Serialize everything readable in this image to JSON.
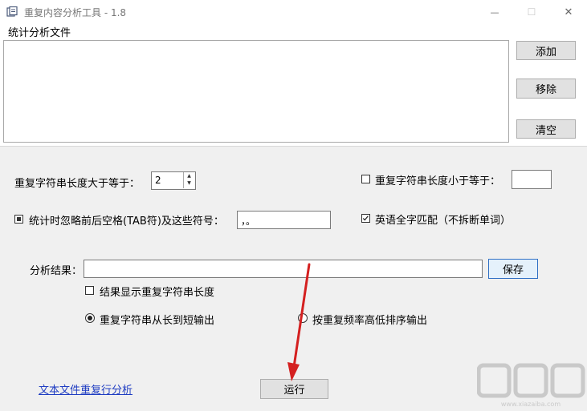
{
  "window": {
    "title": "重复内容分析工具 - 1.8",
    "minimize": "—",
    "maximize": "☐",
    "close": "✕"
  },
  "files": {
    "label": "统计分析文件",
    "add": "添加",
    "remove": "移除",
    "clear": "清空"
  },
  "options": {
    "min_len_label": "重复字符串长度大于等于：",
    "min_len_value": "2",
    "max_len_label": "重复字符串长度小于等于：",
    "max_len_checked": false,
    "max_len_value": "",
    "ignore_label": "统计时忽略前后空格(TAB符)及这些符号：",
    "ignore_checked": true,
    "ignore_value": "，。",
    "english_label": "英语全字匹配（不拆断单词）",
    "english_checked": true
  },
  "result": {
    "label": "分析结果：",
    "path_value": "",
    "save": "保存",
    "show_len_label": "结果显示重复字符串长度",
    "show_len_checked": false,
    "sort_long_short": "重复字符串从长到短输出",
    "sort_freq": "按重复频率高低排序输出",
    "selected_sort": "long_short"
  },
  "footer": {
    "link": "文本文件重复行分析",
    "run": "运行"
  },
  "watermark": {
    "text": "下载吧",
    "subtext": "www.xiazaiba.com"
  },
  "colors": {
    "accent_link": "#1f3dc2",
    "arrow": "#d42020",
    "panel": "#f0f0f0"
  }
}
